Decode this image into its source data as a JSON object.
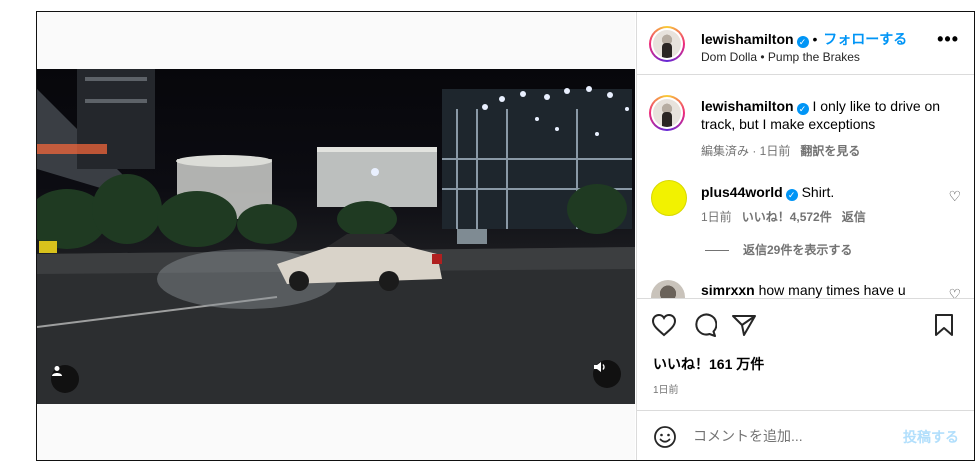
{
  "post": {
    "username": "lewishamilton",
    "separator": "•",
    "follow_label": "フォローする",
    "audio": "Dom Dolla • Pump the Brakes",
    "more_label": "•••"
  },
  "caption": {
    "username": "lewishamilton",
    "text": "I only like to drive on track, but I make exceptions",
    "edited": "編集済み · 1日前",
    "translate": "翻訳を見る"
  },
  "comments": [
    {
      "username": "plus44world",
      "text": "Shirt.",
      "time": "1日前",
      "likes": "いいね！4,572件",
      "reply": "返信",
      "view_replies": "返信29件を表示する"
    },
    {
      "username": "simrxxn",
      "text": "how many times have u"
    }
  ],
  "actions": {
    "likes": "いいね！161 万件",
    "date": "1日前"
  },
  "composer": {
    "placeholder": "コメントを追加...",
    "post_label": "投稿する"
  },
  "colors": {
    "accent": "#0095f6",
    "verified": "#0095f6",
    "post_disabled": "#b2dffc"
  },
  "icons": [
    "heart-icon",
    "comment-icon",
    "share-icon",
    "bookmark-icon",
    "emoji-icon",
    "user-tag-icon",
    "volume-icon",
    "more-icon",
    "verified-icon"
  ]
}
